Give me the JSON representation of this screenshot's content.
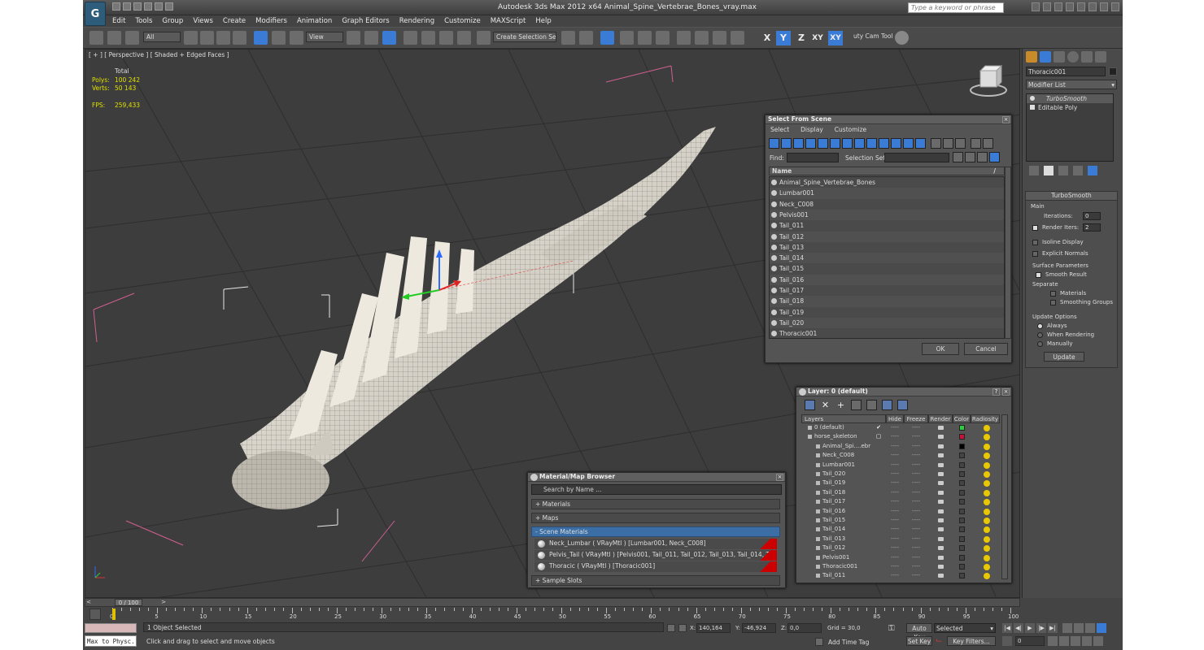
{
  "app": {
    "title": "Autodesk 3ds Max  2012 x64     Animal_Spine_Vertebrae_Bones_vray.max",
    "search_placeholder": "Type a keyword or phrase",
    "logo_icon": "3dsmax-logo-icon"
  },
  "menu": [
    "Edit",
    "Tools",
    "Group",
    "Views",
    "Create",
    "Modifiers",
    "Animation",
    "Graph Editors",
    "Rendering",
    "Customize",
    "MAXScript",
    "Help"
  ],
  "toolbar": {
    "selection_filter": "All",
    "ref_coord": "View",
    "named_selection": "Create Selection Se",
    "axis_x": "X",
    "axis_y": "Y",
    "axis_z": "Z",
    "axis_xy": "XY",
    "axis_xy2": "XY",
    "cam_tool": "uty Cam Tool v"
  },
  "viewport": {
    "label": "[ + ] [ Perspective ] [ Shaded + Edged Faces ]",
    "stats_header": "Total",
    "polys_label": "Polys:",
    "polys": "100 242",
    "verts_label": "Verts:",
    "verts": "50 143",
    "fps_label": "FPS:",
    "fps": "259,433"
  },
  "select_from_scene": {
    "title": "Select From Scene",
    "menu": [
      "Select",
      "Display",
      "Customize"
    ],
    "find_label": "Find:",
    "selection_set_label": "Selection Set:",
    "name_header": "Name",
    "sort_indicator": "/",
    "items": [
      "Animal_Spine_Vertebrae_Bones",
      "Lumbar001",
      "Neck_C008",
      "Pelvis001",
      "Tail_011",
      "Tail_012",
      "Tail_013",
      "Tail_014",
      "Tail_015",
      "Tail_016",
      "Tail_017",
      "Tail_018",
      "Tail_019",
      "Tail_020",
      "Thoracic001"
    ],
    "ok": "OK",
    "cancel": "Cancel"
  },
  "material_browser": {
    "title": "Material/Map Browser",
    "search_placeholder": "Search by Name ...",
    "sections": [
      "+ Materials",
      "+ Maps",
      "- Scene Materials",
      "+ Sample Slots"
    ],
    "materials": [
      "Neck_Lumbar  ( VRayMtl )  [Lumbar001, Neck_C008]",
      "Pelvis_Tail  ( VRayMtl )  [Pelvis001, Tail_011, Tail_012, Tail_013, Tail_014, Tail_0...",
      "Thoracic  ( VRayMtl )  [Thoracic001]"
    ]
  },
  "layer_dialog": {
    "title": "Layer: 0 (default)",
    "help": "?",
    "headers": [
      "Layers",
      "Hide",
      "Freeze",
      "Render",
      "Color",
      "Radiosity"
    ],
    "rows": [
      {
        "name": "0 (default)",
        "indent": 0,
        "color": "#2ecc40",
        "check": "✔"
      },
      {
        "name": "horse_skeleton",
        "indent": 0,
        "color": "#c8103a",
        "check": "▢"
      },
      {
        "name": "Animal_Spi....ebr",
        "indent": 1,
        "color": "#000000",
        "check": ""
      },
      {
        "name": "Neck_C008",
        "indent": 1,
        "color": "",
        "check": ""
      },
      {
        "name": "Lumbar001",
        "indent": 1,
        "color": "",
        "check": ""
      },
      {
        "name": "Tail_020",
        "indent": 1,
        "color": "",
        "check": ""
      },
      {
        "name": "Tail_019",
        "indent": 1,
        "color": "",
        "check": ""
      },
      {
        "name": "Tail_018",
        "indent": 1,
        "color": "",
        "check": ""
      },
      {
        "name": "Tail_017",
        "indent": 1,
        "color": "",
        "check": ""
      },
      {
        "name": "Tail_016",
        "indent": 1,
        "color": "",
        "check": ""
      },
      {
        "name": "Tail_015",
        "indent": 1,
        "color": "",
        "check": ""
      },
      {
        "name": "Tail_014",
        "indent": 1,
        "color": "",
        "check": ""
      },
      {
        "name": "Tail_013",
        "indent": 1,
        "color": "",
        "check": ""
      },
      {
        "name": "Tail_012",
        "indent": 1,
        "color": "",
        "check": ""
      },
      {
        "name": "Pelvis001",
        "indent": 1,
        "color": "",
        "check": ""
      },
      {
        "name": "Thoracic001",
        "indent": 1,
        "color": "",
        "check": ""
      },
      {
        "name": "Tail_011",
        "indent": 1,
        "color": "",
        "check": ""
      }
    ],
    "dash": "----"
  },
  "command_panel": {
    "object_name": "Thoracic001",
    "modifier_list": "Modifier List",
    "stack": [
      "TurboSmooth",
      "Editable Poly"
    ],
    "turbosmooth": {
      "title": "TurboSmooth",
      "main": "Main",
      "iterations_label": "Iterations:",
      "iterations": "0",
      "render_iters_label": "Render Iters:",
      "render_iters": "2",
      "isoline": "Isoline Display",
      "explicit": "Explicit Normals"
    },
    "surface": {
      "title": "Surface Parameters",
      "smooth_result": "Smooth Result",
      "separate": "Separate",
      "materials": "Materials",
      "smoothing_groups": "Smoothing Groups"
    },
    "update": {
      "title": "Update Options",
      "always": "Always",
      "when_rendering": "When Rendering",
      "manually": "Manually",
      "button": "Update"
    }
  },
  "timeline": {
    "frame": "0 / 100",
    "ticks": [
      "0",
      "5",
      "10",
      "15",
      "20",
      "25",
      "30",
      "35",
      "40",
      "45",
      "50",
      "55",
      "60",
      "65",
      "70",
      "75",
      "80",
      "85",
      "90",
      "95",
      "100"
    ],
    "prev": "<",
    "next": ">"
  },
  "status": {
    "selected": "1 Object Selected",
    "prompt": "Click and drag to select and move objects",
    "maxscript": "Max to Physc.",
    "x_label": "X:",
    "x": "140,164",
    "y_label": "Y:",
    "y": "-46,924",
    "z_label": "Z:",
    "z": "0,0",
    "grid": "Grid = 30,0",
    "add_time_tag": "Add Time Tag",
    "auto_key": "Auto Key",
    "set_key": "Set Key",
    "key_mode": "Selected",
    "key_filters": "Key Filters...",
    "current_frame": "0"
  }
}
